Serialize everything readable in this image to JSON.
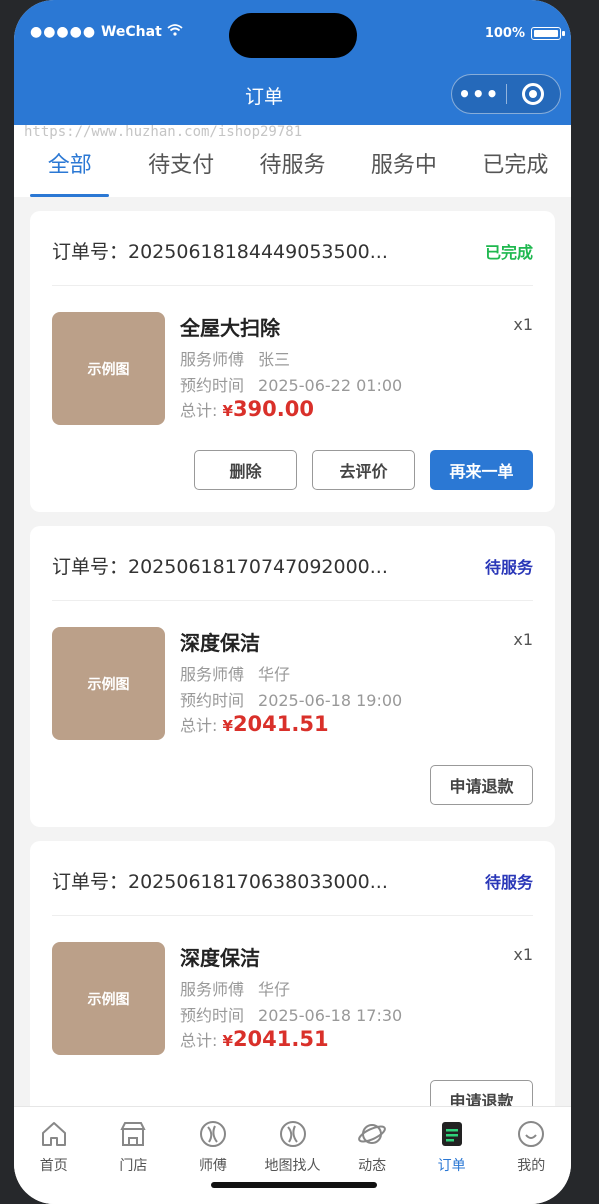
{
  "status_bar": {
    "carrier": "WeChat",
    "battery": "100%"
  },
  "nav": {
    "title": "订单",
    "more": "•••"
  },
  "watermark": "https://www.huzhan.com/ishop29781",
  "tabs": [
    "全部",
    "待支付",
    "待服务",
    "服务中",
    "已完成"
  ],
  "active_tab": 0,
  "orders": [
    {
      "order_no": "订单号：20250618184449053500...",
      "status": "已完成",
      "status_color": "#1fb84f",
      "image_label": "示例图",
      "service": "全屋大扫除",
      "qty": "x1",
      "worker_label": "服务师傅",
      "worker": "张三",
      "time_label": "预约时间",
      "time": "2025-06-22 01:00",
      "total_label": "总计:",
      "currency": "¥",
      "amount": "390.00",
      "actions": [
        "删除",
        "去评价",
        "再来一单"
      ]
    },
    {
      "order_no": "订单号：20250618170747092000...",
      "status": "待服务",
      "status_color": "#2a37b8",
      "image_label": "示例图",
      "service": "深度保洁",
      "qty": "x1",
      "worker_label": "服务师傅",
      "worker": "华仔",
      "time_label": "预约时间",
      "time": "2025-06-18 19:00",
      "total_label": "总计:",
      "currency": "¥",
      "amount": "2041.51",
      "actions": [
        "申请退款"
      ]
    },
    {
      "order_no": "订单号：20250618170638033000...",
      "status": "待服务",
      "status_color": "#2a37b8",
      "image_label": "示例图",
      "service": "深度保洁",
      "qty": "x1",
      "worker_label": "服务师傅",
      "worker": "华仔",
      "time_label": "预约时间",
      "time": "2025-06-18 17:30",
      "total_label": "总计:",
      "currency": "¥",
      "amount": "2041.51",
      "actions": [
        "申请退款"
      ]
    }
  ],
  "tabbar": [
    {
      "label": "首页",
      "icon": "home-icon"
    },
    {
      "label": "门店",
      "icon": "store-icon"
    },
    {
      "label": "师傅",
      "icon": "worker-icon"
    },
    {
      "label": "地图找人",
      "icon": "map-icon"
    },
    {
      "label": "动态",
      "icon": "planet-icon"
    },
    {
      "label": "订单",
      "icon": "order-icon"
    },
    {
      "label": "我的",
      "icon": "profile-icon"
    }
  ],
  "tabbar_active": 5,
  "colors": {
    "brand": "#2b78d4",
    "price": "#d9302a"
  }
}
